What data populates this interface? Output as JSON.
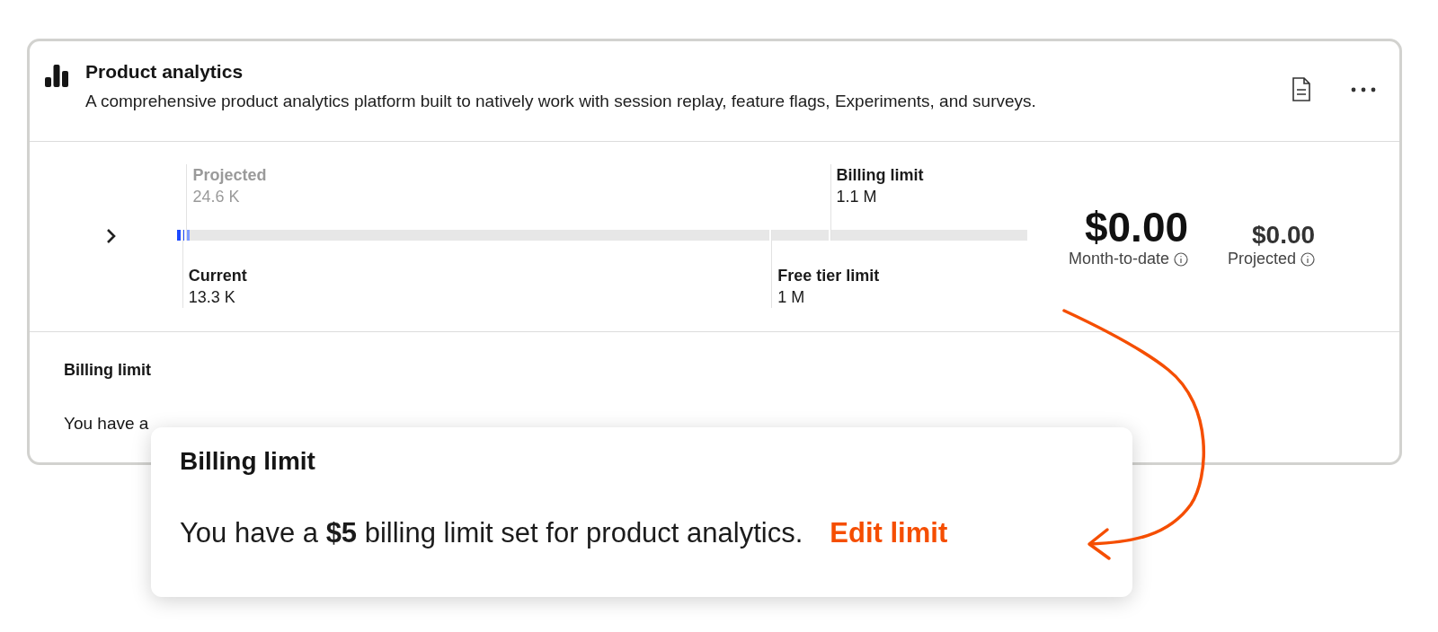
{
  "card": {
    "title": "Product analytics",
    "description": "A comprehensive product analytics platform built to natively work with session replay, feature flags, Experiments, and surveys.",
    "usage": {
      "fills": [
        {
          "kind": "projected",
          "level": 0.015
        },
        {
          "kind": "current",
          "level": 0.008
        }
      ],
      "above": [
        {
          "muted": true,
          "label": "Projected",
          "value": "24.6 K",
          "level": 0.011
        },
        {
          "muted": false,
          "label": "Billing limit",
          "value": "1.1 M",
          "level": 0.768
        }
      ],
      "below": [
        {
          "muted": false,
          "label": "Current",
          "value": "13.3 K",
          "level": 0.006
        },
        {
          "muted": false,
          "label": "Free tier limit",
          "value": "1 M",
          "level": 0.699
        }
      ]
    },
    "amounts": {
      "month_to_date": {
        "value": "$0.00",
        "label": "Month-to-date"
      },
      "projected": {
        "value": "$0.00",
        "label": "Projected"
      }
    },
    "billing_limit": {
      "title": "Billing limit",
      "text": "You have a"
    }
  },
  "callout": {
    "title": "Billing limit",
    "text": "You have a **$5** billing limit set for product analytics.",
    "link": "Edit limit"
  }
}
